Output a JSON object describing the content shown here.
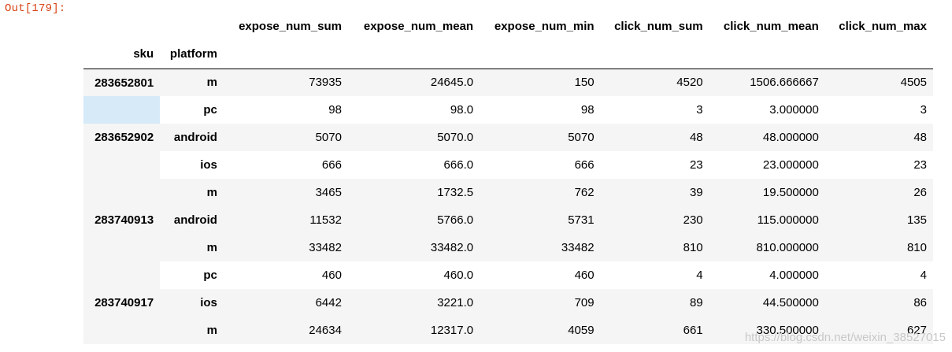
{
  "prompt": "Out[179]:",
  "columns": [
    "expose_num_sum",
    "expose_num_mean",
    "expose_num_min",
    "click_num_sum",
    "click_num_mean",
    "click_num_max"
  ],
  "index_names": [
    "sku",
    "platform"
  ],
  "rows": [
    {
      "sku": "283652801",
      "platform": "m",
      "values": [
        "73935",
        "24645.0",
        "150",
        "4520",
        "1506.666667",
        "4505"
      ]
    },
    {
      "sku": "",
      "platform": "pc",
      "values": [
        "98",
        "98.0",
        "98",
        "3",
        "3.000000",
        "3"
      ]
    },
    {
      "sku": "283652902",
      "platform": "android",
      "values": [
        "5070",
        "5070.0",
        "5070",
        "48",
        "48.000000",
        "48"
      ]
    },
    {
      "sku": "",
      "platform": "ios",
      "values": [
        "666",
        "666.0",
        "666",
        "23",
        "23.000000",
        "23"
      ]
    },
    {
      "sku": "",
      "platform": "m",
      "values": [
        "3465",
        "1732.5",
        "762",
        "39",
        "19.500000",
        "26"
      ]
    },
    {
      "sku": "283740913",
      "platform": "android",
      "values": [
        "11532",
        "5766.0",
        "5731",
        "230",
        "115.000000",
        "135"
      ]
    },
    {
      "sku": "",
      "platform": "m",
      "values": [
        "33482",
        "33482.0",
        "33482",
        "810",
        "810.000000",
        "810"
      ]
    },
    {
      "sku": "",
      "platform": "pc",
      "values": [
        "460",
        "460.0",
        "460",
        "4",
        "4.000000",
        "4"
      ]
    },
    {
      "sku": "283740917",
      "platform": "ios",
      "values": [
        "6442",
        "3221.0",
        "709",
        "89",
        "44.500000",
        "86"
      ]
    },
    {
      "sku": "",
      "platform": "m",
      "values": [
        "24634",
        "12317.0",
        "4059",
        "661",
        "330.500000",
        "627"
      ]
    }
  ],
  "watermark": "https://blog.csdn.net/weixin_38527015"
}
